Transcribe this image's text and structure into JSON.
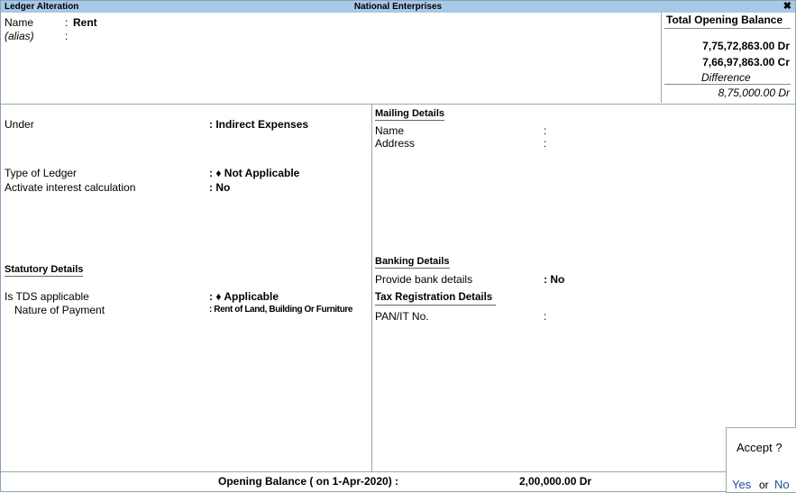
{
  "titlebar": {
    "left": "Ledger Alteration",
    "center": "National Enterprises",
    "close": "✖"
  },
  "header": {
    "name_label": "Name",
    "name_sep": ":",
    "name_value": "Rent",
    "alias_label": "(alias)",
    "alias_sep": ":"
  },
  "opening_box": {
    "title": "Total Opening Balance",
    "dr_total": "7,75,72,863.00 Dr",
    "cr_total": "7,66,97,863.00 Cr",
    "difference_label": "Difference",
    "difference_value": "8,75,000.00 Dr"
  },
  "left_panel": {
    "under_label": "Under",
    "under_value": ": Indirect Expenses",
    "type_label": "Type of Ledger",
    "type_value": ": ♦ Not Applicable",
    "interest_label": "Activate interest calculation",
    "interest_value": ": No",
    "statutory_heading": "Statutory Details",
    "tds_label": "Is TDS applicable",
    "tds_value": ": ♦ Applicable",
    "nature_label": "Nature of Payment",
    "nature_value": ": Rent of Land, Building Or Furniture"
  },
  "right_panel": {
    "mailing_heading": "Mailing Details",
    "mail_name_label": "Name",
    "mail_name_sep": ":",
    "address_label": "Address",
    "address_sep": ":",
    "banking_heading": "Banking Details",
    "bank_label": "Provide bank details",
    "bank_value": ": No",
    "tax_heading": "Tax Registration Details",
    "pan_label": "PAN/IT No.",
    "pan_sep": ":"
  },
  "footer": {
    "opening_label": "Opening Balance  ( on 1-Apr-2020) :",
    "opening_value": "2,00,000.00 Dr"
  },
  "accept_dialog": {
    "prompt": "Accept ?",
    "yes": "Yes",
    "or": "or",
    "no": "No"
  },
  "colors": {
    "titlebar_bg": "#a8c8e8",
    "yes_no": "#1a4fa0"
  }
}
